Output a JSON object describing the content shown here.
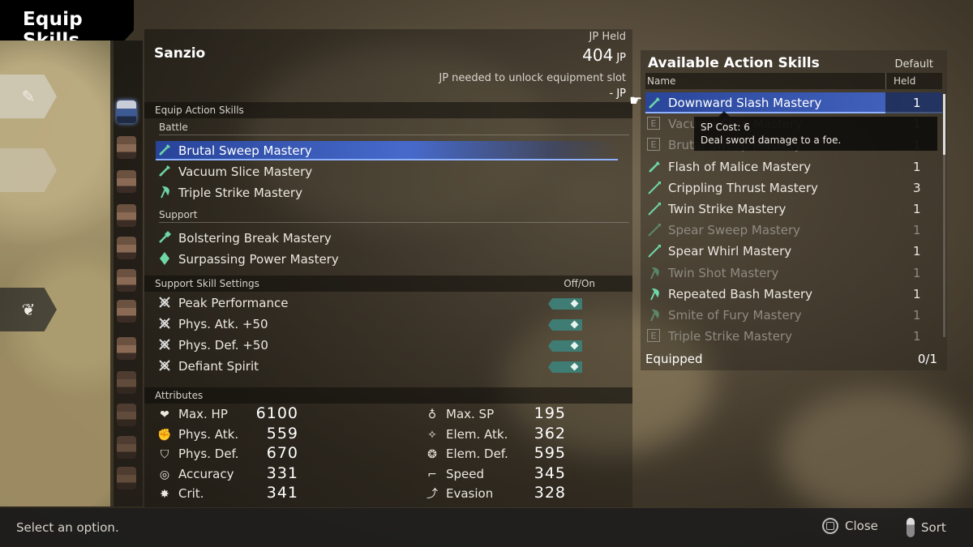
{
  "screen_title": "Equip Skills",
  "character": {
    "name": "Sanzio",
    "jp_held_label": "JP Held",
    "jp_held_value": "404",
    "jp_unit": "JP",
    "jp_needed_label": "JP needed to unlock equipment slot",
    "jp_needed_value": "- JP"
  },
  "equip_action_skills": {
    "section_label": "Equip Action Skills",
    "battle_label": "Battle",
    "battle": [
      {
        "label": "Brutal Sweep Mastery",
        "icon": "sword-icon",
        "selected": true
      },
      {
        "label": "Vacuum Slice Mastery",
        "icon": "sword-icon",
        "selected": false
      },
      {
        "label": "Triple Strike Mastery",
        "icon": "axe-icon",
        "selected": false
      }
    ],
    "support_label": "Support",
    "support": [
      {
        "label": "Bolstering Break Mastery",
        "icon": "sword-gem-icon"
      },
      {
        "label": "Surpassing Power Mastery",
        "icon": "gem-icon"
      }
    ]
  },
  "support_settings": {
    "section_label": "Support Skill Settings",
    "toggle_header": "Off/On",
    "items": [
      {
        "label": "Peak Performance",
        "icon": "crossed-swords-icon",
        "on": true
      },
      {
        "label": "Phys. Atk. +50",
        "icon": "crossed-swords-icon",
        "on": true
      },
      {
        "label": "Phys. Def. +50",
        "icon": "crossed-swords-icon",
        "on": true
      },
      {
        "label": "Defiant Spirit",
        "icon": "crossed-swords-icon",
        "on": true
      }
    ]
  },
  "attributes": {
    "section_label": "Attributes",
    "left": [
      {
        "label": "Max. HP",
        "value": "6100",
        "icon": "heart-icon"
      },
      {
        "label": "Phys. Atk.",
        "value": "559",
        "icon": "fist-icon"
      },
      {
        "label": "Phys. Def.",
        "value": "670",
        "icon": "shield-fist-icon"
      },
      {
        "label": "Accuracy",
        "value": "331",
        "icon": "target-icon"
      },
      {
        "label": "Crit.",
        "value": "341",
        "icon": "burst-icon"
      }
    ],
    "right": [
      {
        "label": "Max. SP",
        "value": "195",
        "icon": "sp-icon"
      },
      {
        "label": "Elem. Atk.",
        "value": "362",
        "icon": "elem-atk-icon"
      },
      {
        "label": "Elem. Def.",
        "value": "595",
        "icon": "elem-def-icon"
      },
      {
        "label": "Speed",
        "value": "345",
        "icon": "boot-icon"
      },
      {
        "label": "Evasion",
        "value": "328",
        "icon": "evasion-icon"
      }
    ]
  },
  "available": {
    "title": "Available Action Skills",
    "sort_label": "Default",
    "col_name": "Name",
    "col_held": "Held",
    "items": [
      {
        "label": "Downward Slash Mastery",
        "held": "1",
        "icon": "sword-icon",
        "dim": false,
        "selected": true
      },
      {
        "label": "Vacuum Slice Mastery",
        "held": "1",
        "icon": "equipped-e-icon",
        "dim": true,
        "selected": false
      },
      {
        "label": "Brutal Sweep Mastery",
        "held": "1",
        "icon": "equipped-e-icon",
        "dim": true,
        "selected": false
      },
      {
        "label": "Flash of Malice Mastery",
        "held": "1",
        "icon": "sword-icon",
        "dim": false,
        "selected": false
      },
      {
        "label": "Crippling Thrust Mastery",
        "held": "3",
        "icon": "spear-icon",
        "dim": false,
        "selected": false
      },
      {
        "label": "Twin Strike Mastery",
        "held": "1",
        "icon": "spear-icon",
        "dim": false,
        "selected": false
      },
      {
        "label": "Spear Sweep Mastery",
        "held": "1",
        "icon": "spear-icon",
        "dim": true,
        "selected": false
      },
      {
        "label": "Spear Whirl Mastery",
        "held": "1",
        "icon": "spear-icon",
        "dim": false,
        "selected": false
      },
      {
        "label": "Twin Shot Mastery",
        "held": "1",
        "icon": "axe-icon",
        "dim": true,
        "selected": false
      },
      {
        "label": "Repeated Bash Mastery",
        "held": "1",
        "icon": "axe-icon",
        "dim": false,
        "selected": false
      },
      {
        "label": "Smite of Fury Mastery",
        "held": "1",
        "icon": "axe-icon",
        "dim": true,
        "selected": false
      },
      {
        "label": "Triple Strike Mastery",
        "held": "1",
        "icon": "equipped-e-icon",
        "dim": true,
        "selected": false
      }
    ],
    "tooltip": {
      "cost": "SP Cost: 6",
      "desc": "Deal sword damage to a foe."
    },
    "equipped_label": "Equipped",
    "equipped_count": "0/1"
  },
  "footer": {
    "hint": "Select an option.",
    "close_label": "Close",
    "sort_label": "Sort"
  },
  "colors": {
    "selection_blue": "#4a6fd8",
    "toggle_teal": "#3f7d74",
    "skill_icon_green": "#6fd6a6"
  }
}
